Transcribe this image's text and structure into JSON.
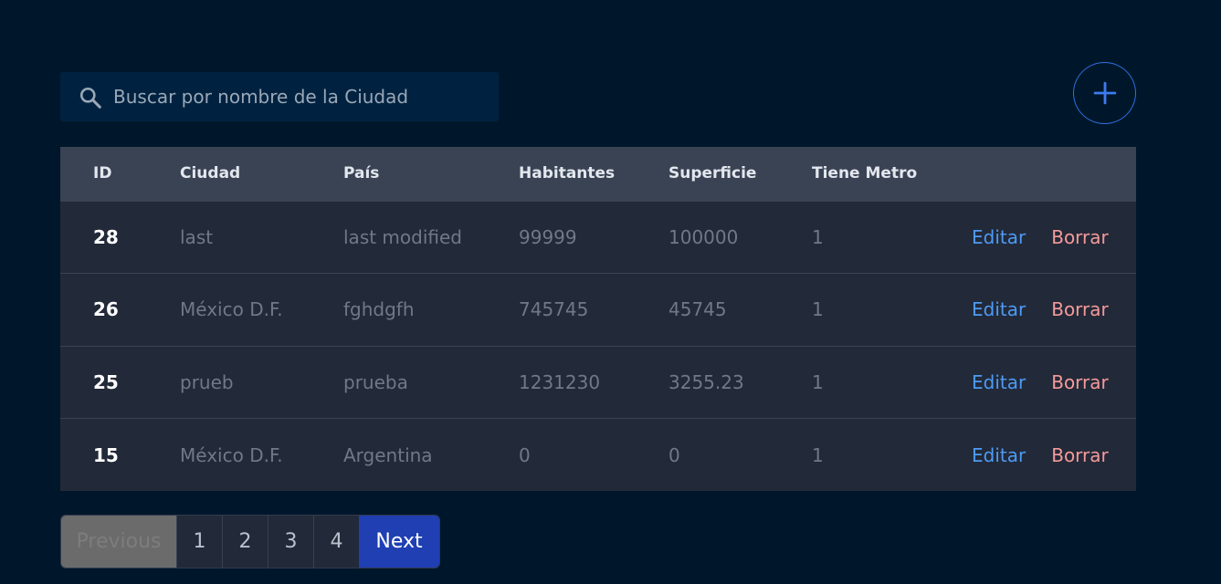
{
  "search": {
    "placeholder": "Buscar por nombre de la Ciudad",
    "icon": "search-icon"
  },
  "add_button": {
    "icon": "plus-icon",
    "color": "#2f6fe0"
  },
  "table": {
    "headers": [
      "ID",
      "Ciudad",
      "País",
      "Habitantes",
      "Superficie",
      "Tiene Metro"
    ],
    "rows": [
      {
        "id": "28",
        "ciudad": "last",
        "pais": "last modified",
        "habitantes": "99999",
        "superficie": "100000",
        "metro": "1",
        "edit": "Editar",
        "delete": "Borrar"
      },
      {
        "id": "26",
        "ciudad": "México D.F.",
        "pais": "fghdgfh",
        "habitantes": "745745",
        "superficie": "45745",
        "metro": "1",
        "edit": "Editar",
        "delete": "Borrar"
      },
      {
        "id": "25",
        "ciudad": "prueb",
        "pais": "prueba",
        "habitantes": "1231230",
        "superficie": "3255.23",
        "metro": "1",
        "edit": "Editar",
        "delete": "Borrar"
      },
      {
        "id": "15",
        "ciudad": "México D.F.",
        "pais": "Argentina",
        "habitantes": "0",
        "superficie": "0",
        "metro": "1",
        "edit": "Editar",
        "delete": "Borrar"
      }
    ]
  },
  "pagination": {
    "previous": "Previous",
    "pages": [
      "1",
      "2",
      "3",
      "4"
    ],
    "next": "Next"
  },
  "colors": {
    "background": "#00172b",
    "edit": "#4d9bf5",
    "delete": "#f59a9a",
    "next_button": "#1f3fb3"
  }
}
